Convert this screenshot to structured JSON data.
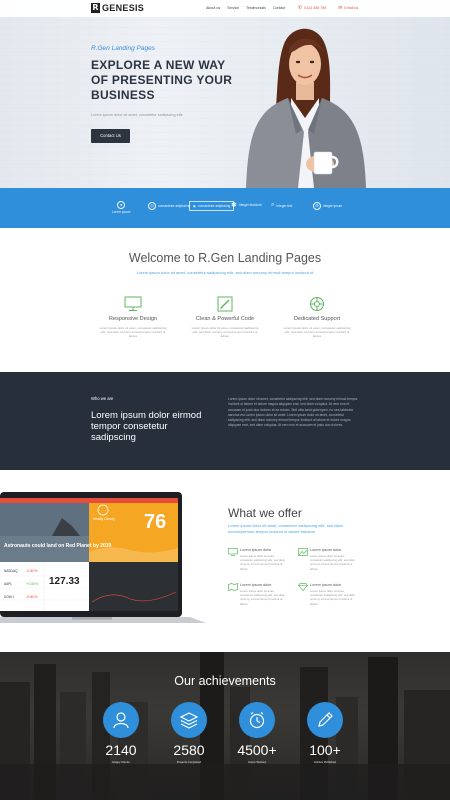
{
  "header": {
    "logo_mark": "R",
    "logo_text": "GENESIS",
    "nav": [
      "About us",
      "Service",
      "Testimonials",
      "Contact"
    ],
    "phone": "0123 456 789",
    "email": "Email us"
  },
  "hero": {
    "subtitle": "R.Gen Landing Pages",
    "title": "EXPLORE A NEW WAY OF PRESENTING YOUR BUSINESS",
    "description": "Lorem ipsum dolor sit amet, consetetur sadipscing elitr",
    "button": "Contact Us"
  },
  "partners": [
    {
      "icon": "person-icon",
      "label": "Lorem ipsum"
    },
    {
      "icon": "globe-icon",
      "label": "consectetur adipisicing"
    },
    {
      "icon": "frame-icon",
      "label": "consectetur adipisicing"
    },
    {
      "icon": "star-icon",
      "label": "Integer tincidunt"
    },
    {
      "icon": "search-icon",
      "label": "Integer text"
    },
    {
      "icon": "gear-icon",
      "label": "integer ipsum"
    }
  ],
  "welcome": {
    "title": "Welcome to R.Gen Landing Pages",
    "subtitle": "Lorem ipsum dolor sit amet, consetetur sadipscing elitr, sed diam nonumy eirmod tempor invidunt ut",
    "features": [
      {
        "icon": "monitor-icon",
        "title": "Responsive Design",
        "text": "Lorem ipsum dolor sit amet, consetetur sadipscing elitr, sed diam nonumy eirmod tempor invidunt ut labore"
      },
      {
        "icon": "pencil-icon",
        "title": "Clean & Powerful Code",
        "text": "Lorem ipsum dolor sit amet, consetetur sadipscing elitr, sed diam nonumy eirmod tempor invidunt ut labore"
      },
      {
        "icon": "support-icon",
        "title": "Dedicated Support",
        "text": "Lorem ipsum dolor sit amet, consetetur sadipscing elitr, sed diam nonumy eirmod tempor invidunt ut labore"
      }
    ]
  },
  "who": {
    "label": "Who we are",
    "title": "Lorem ipsum dolor eirmod tempor consetetur sadipscing",
    "text": "Lorem ipsum dolor sit amet, consetetur sadipscing elitr, sed diam nonumy eirmod tempor invidunt ut labore et dolore magna aliquyam erat, sed diam voluptua. At vero eos et accusam et justo duo dolores et ea rebum. Stet clita kasd gubergren, no sea takimata sanctus est Lorem ipsum dolor sit amet. Lorem ipsum dolor sit amet, consetetur sadipscing elitr, sed diam nonumy eirmod tempor invidunt ut labore et dolore magna aliquyam erat, sed diam voluptua. At vero eos et accusam et justo duo dolores."
  },
  "laptop_screen": {
    "headline": "Astronauts could land on Red Planet by 2039",
    "weather_label": "Mostly Cloudy",
    "temperature": "76",
    "stocks": [
      {
        "name": "NASDAQ",
        "change": "-0.80%"
      },
      {
        "name": "AAPL",
        "change": "+0.80%"
      },
      {
        "name": "DOW J",
        "change": "-0.80%"
      }
    ],
    "stock_value": "127.33"
  },
  "offer": {
    "title": "What we offer",
    "subtitle": "Lorem ipsum dolor sit amet, consetetur sadipscing elitr, sed diam nonumyeirmod tempor invidunt ut labore etdolore",
    "items": [
      {
        "icon": "monitor-icon",
        "title": "Lorem ipsum dolor",
        "text": "Lorem ipsum dolor sit amet, consetetur sadipscing elitr, sed diam nonumy eirmod tempor invidunt ut labore"
      },
      {
        "icon": "image-icon",
        "title": "Lorem ipsum dolor",
        "text": "Lorem ipsum dolor sit amet, consetetur sadipscing elitr, sed diam nonumy eirmod tempor invidunt ut labore"
      },
      {
        "icon": "map-icon",
        "title": "Lorem ipsum dolor",
        "text": "Lorem ipsum dolor sit amet, consetetur sadipscing elitr, sed diam nonumy eirmod tempor invidunt ut labore"
      },
      {
        "icon": "diamond-icon",
        "title": "Lorem ipsum dolor",
        "text": "Lorem ipsum dolor sit amet, consetetur sadipscing elitr, sed diam nonumy eirmod tempor invidunt ut labore"
      }
    ]
  },
  "achievements": {
    "title": "Our achievements",
    "stats": [
      {
        "icon": "user-icon",
        "number": "2140",
        "label": "Happy Clients"
      },
      {
        "icon": "layers-icon",
        "number": "2580",
        "label": "Projects Completed"
      },
      {
        "icon": "clock-icon",
        "number": "4500+",
        "label": "Hours Worked"
      },
      {
        "icon": "pencil-icon",
        "number": "100+",
        "label": "Articles Published"
      }
    ]
  },
  "colors": {
    "accent_blue": "#2f8fdb",
    "accent_green": "#5cb85c",
    "accent_red": "#e84e3c",
    "dark": "#272f3b"
  }
}
